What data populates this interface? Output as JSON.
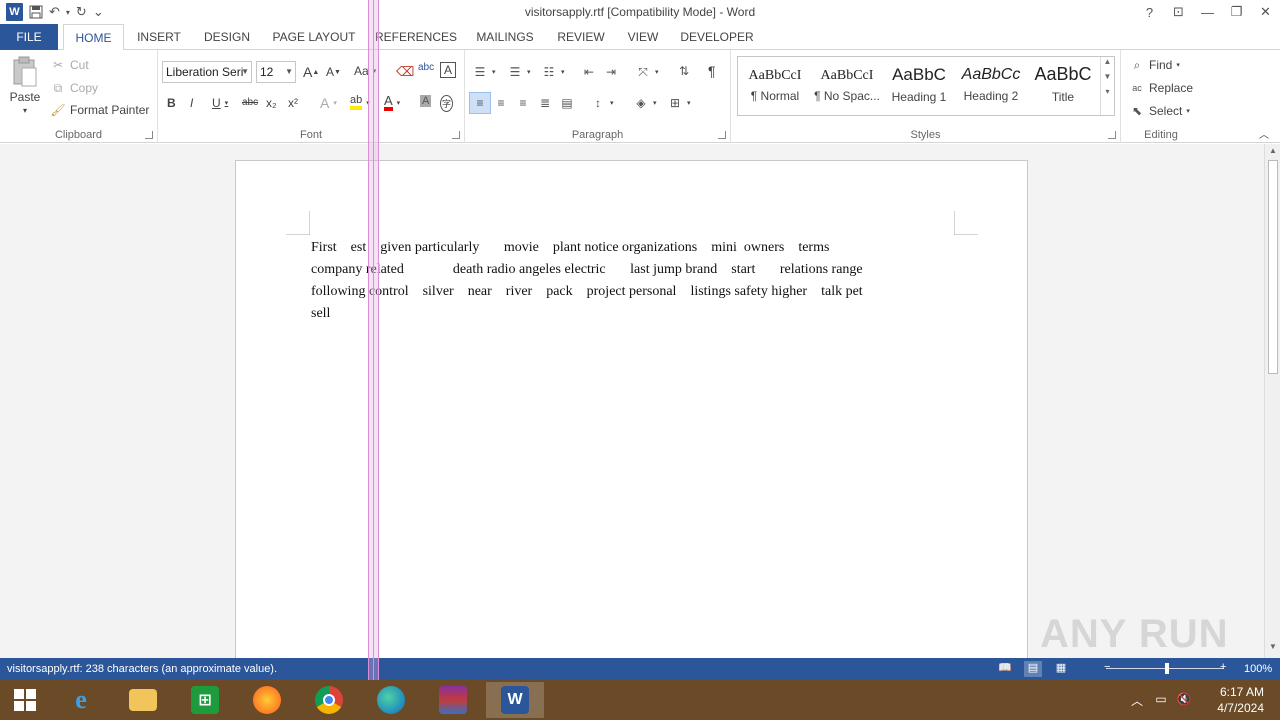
{
  "window": {
    "title": "visitorsapply.rtf [Compatibility Mode] - Word",
    "help": "?",
    "restore_ribbon": "⊡",
    "minimize": "—",
    "maximize": "❐",
    "close": "✕"
  },
  "qat": {
    "word_logo": "W",
    "save": "💾",
    "undo": "↶",
    "redo": "↻",
    "customize": "⌄"
  },
  "tabs": {
    "file": "FILE",
    "home": "HOME",
    "insert": "INSERT",
    "design": "DESIGN",
    "page_layout": "PAGE LAYOUT",
    "references": "REFERENCES",
    "mailings": "MAILINGS",
    "review": "REVIEW",
    "view": "VIEW",
    "developer": "DEVELOPER"
  },
  "clipboard": {
    "label": "Clipboard",
    "paste": "Paste",
    "cut": "Cut",
    "copy": "Copy",
    "format_painter": "Format Painter"
  },
  "font": {
    "label": "Font",
    "name": "Liberation Seri",
    "size": "12",
    "bold": "B",
    "italic": "I",
    "underline": "U",
    "strike": "abc",
    "sub": "x₂",
    "sup": "x²",
    "grow": "A",
    "shrink": "A",
    "case": "Aa",
    "clear": "A",
    "color": "A",
    "highlight": "ab",
    "shade": "A",
    "enclose": "字"
  },
  "paragraph": {
    "label": "Paragraph",
    "pilcrow": "¶"
  },
  "styles": {
    "label": "Styles",
    "items": [
      {
        "sample": "AaBbCcI",
        "name": "¶ Normal"
      },
      {
        "sample": "AaBbCcI",
        "name": "¶ No Spac..."
      },
      {
        "sample": "AaBbC",
        "name": "Heading 1"
      },
      {
        "sample": "AaBbCc",
        "name": "Heading 2"
      },
      {
        "sample": "AaBbC",
        "name": "Title"
      }
    ]
  },
  "editing": {
    "label": "Editing",
    "find": "Find",
    "replace": "Replace",
    "select": "Select"
  },
  "document": {
    "text": "First    est    given particularly       movie    plant notice organizations    mini  owners    terms\ncompany related              death radio angeles electric       last jump brand    start       relations range\nfollowing control    silver    near    river    pack    project personal    listings safety higher    talk pet\nsell"
  },
  "statusbar": {
    "text": "visitorsapply.rtf: 238 characters (an approximate value).",
    "zoom": "100%",
    "zoom_minus": "−",
    "zoom_plus": "+"
  },
  "watermark": "ANY RUN",
  "taskbar": {
    "time": "6:17 AM",
    "date": "4/7/2024"
  },
  "colors": {
    "accent": "#2b579a",
    "taskbar": "#6b4b27"
  }
}
